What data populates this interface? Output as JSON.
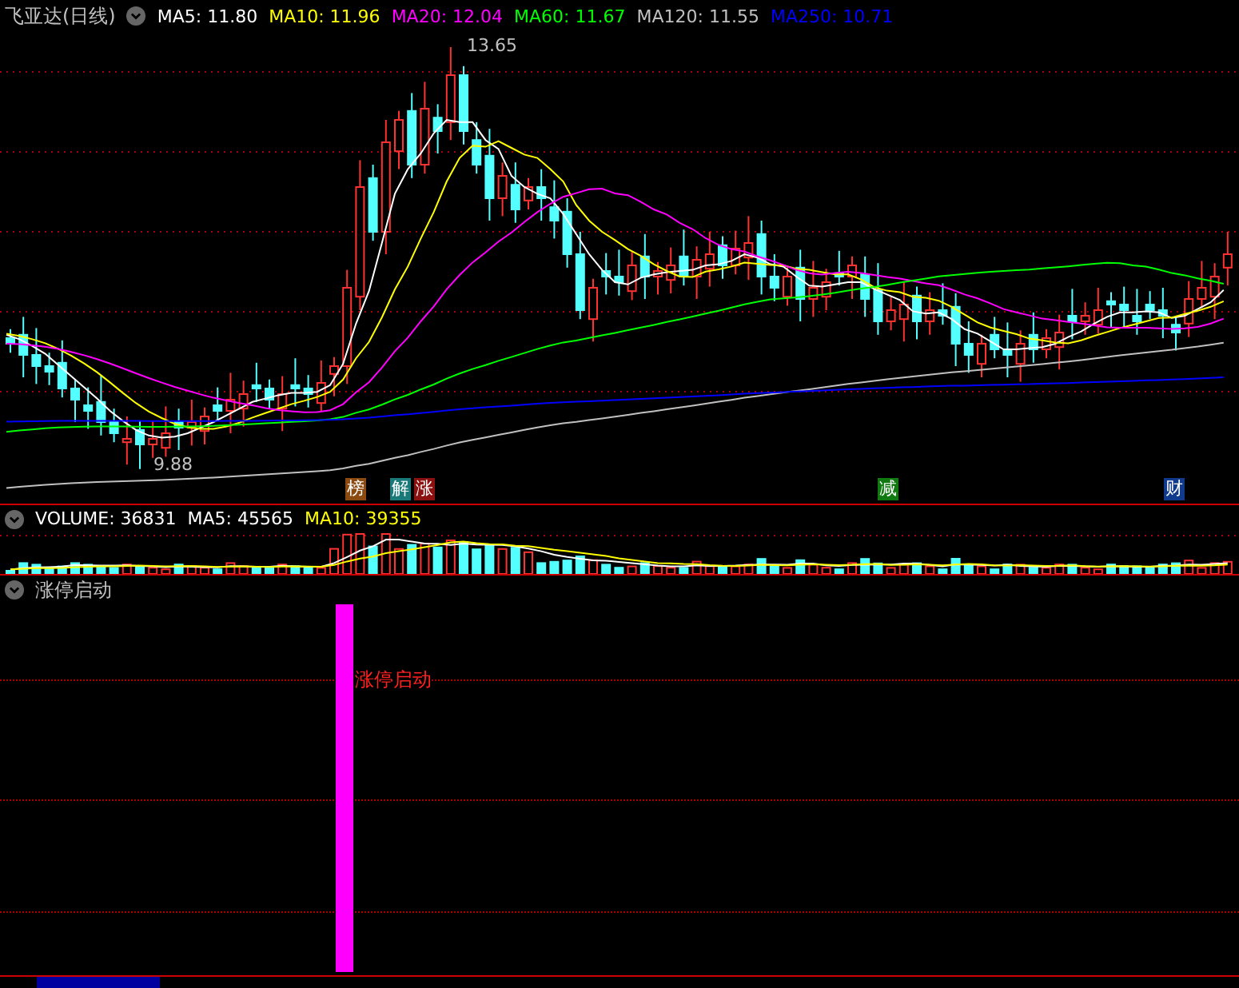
{
  "header": {
    "title": "飞亚达(日线)",
    "averages": [
      {
        "label": "MA5: 11.80",
        "color": "#ffffff"
      },
      {
        "label": "MA10: 11.96",
        "color": "#ffff00"
      },
      {
        "label": "MA20: 12.04",
        "color": "#ff00ff"
      },
      {
        "label": "MA60: 11.67",
        "color": "#00ff00"
      },
      {
        "label": "MA120: 11.55",
        "color": "#c0c0c0"
      },
      {
        "label": "MA250: 10.71",
        "color": "#0000ff"
      }
    ]
  },
  "price_chart": {
    "high_label": "13.65",
    "low_label": "9.88",
    "events": [
      {
        "label": "榜",
        "color": "#8b4a10"
      },
      {
        "label": "解",
        "color": "#1a7a7a"
      },
      {
        "label": "涨",
        "color": "#8b1010"
      },
      {
        "label": "减",
        "color": "#107a10"
      },
      {
        "label": "财",
        "color": "#103a8b"
      }
    ]
  },
  "volume": {
    "averages": [
      {
        "label": "VOLUME: 36831",
        "color": "#ffffff"
      },
      {
        "label": "MA5: 45565",
        "color": "#ffffff"
      },
      {
        "label": "MA10: 39355",
        "color": "#ffff00"
      }
    ]
  },
  "indicator": {
    "title": "涨停启动",
    "signal_label": "涨停启动"
  }
}
